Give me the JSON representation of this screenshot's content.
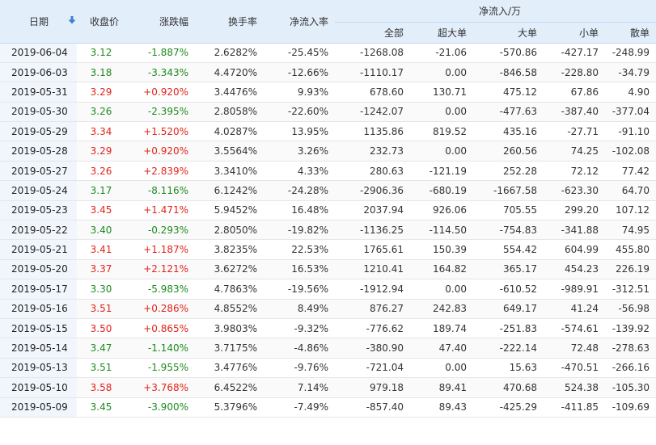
{
  "header": {
    "date": "日期",
    "close": "收盘价",
    "change": "涨跌幅",
    "turnover": "换手率",
    "net_rate": "净流入率",
    "net_flow_group": "净流入/万",
    "all": "全部",
    "xlarge": "超大单",
    "large": "大单",
    "small": "小单",
    "retail": "散单"
  },
  "colors": {
    "up": "#e3231b",
    "down": "#1e8a1e",
    "header_bg": "#e3eefb",
    "sort_icon": "#3b7fd4"
  },
  "rows": [
    {
      "date": "2019-06-04",
      "close": "3.12",
      "change": "-1.887%",
      "turnover": "2.6282%",
      "rate": "-25.45%",
      "all": "-1268.08",
      "xl": "-21.06",
      "l": "-570.86",
      "s": "-427.17",
      "r": "-248.99",
      "dir": "down"
    },
    {
      "date": "2019-06-03",
      "close": "3.18",
      "change": "-3.343%",
      "turnover": "4.4720%",
      "rate": "-12.66%",
      "all": "-1110.17",
      "xl": "0.00",
      "l": "-846.58",
      "s": "-228.80",
      "r": "-34.79",
      "dir": "down"
    },
    {
      "date": "2019-05-31",
      "close": "3.29",
      "change": "+0.920%",
      "turnover": "3.4476%",
      "rate": "9.93%",
      "all": "678.60",
      "xl": "130.71",
      "l": "475.12",
      "s": "67.86",
      "r": "4.90",
      "dir": "up"
    },
    {
      "date": "2019-05-30",
      "close": "3.26",
      "change": "-2.395%",
      "turnover": "2.8058%",
      "rate": "-22.60%",
      "all": "-1242.07",
      "xl": "0.00",
      "l": "-477.63",
      "s": "-387.40",
      "r": "-377.04",
      "dir": "down"
    },
    {
      "date": "2019-05-29",
      "close": "3.34",
      "change": "+1.520%",
      "turnover": "4.0287%",
      "rate": "13.95%",
      "all": "1135.86",
      "xl": "819.52",
      "l": "435.16",
      "s": "-27.71",
      "r": "-91.10",
      "dir": "up"
    },
    {
      "date": "2019-05-28",
      "close": "3.29",
      "change": "+0.920%",
      "turnover": "3.5564%",
      "rate": "3.26%",
      "all": "232.73",
      "xl": "0.00",
      "l": "260.56",
      "s": "74.25",
      "r": "-102.08",
      "dir": "up"
    },
    {
      "date": "2019-05-27",
      "close": "3.26",
      "change": "+2.839%",
      "turnover": "3.3410%",
      "rate": "4.33%",
      "all": "280.63",
      "xl": "-121.19",
      "l": "252.28",
      "s": "72.12",
      "r": "77.42",
      "dir": "up"
    },
    {
      "date": "2019-05-24",
      "close": "3.17",
      "change": "-8.116%",
      "turnover": "6.1242%",
      "rate": "-24.28%",
      "all": "-2906.36",
      "xl": "-680.19",
      "l": "-1667.58",
      "s": "-623.30",
      "r": "64.70",
      "dir": "down"
    },
    {
      "date": "2019-05-23",
      "close": "3.45",
      "change": "+1.471%",
      "turnover": "5.9452%",
      "rate": "16.48%",
      "all": "2037.94",
      "xl": "926.06",
      "l": "705.55",
      "s": "299.20",
      "r": "107.12",
      "dir": "up"
    },
    {
      "date": "2019-05-22",
      "close": "3.40",
      "change": "-0.293%",
      "turnover": "2.8050%",
      "rate": "-19.82%",
      "all": "-1136.25",
      "xl": "-114.50",
      "l": "-754.83",
      "s": "-341.88",
      "r": "74.95",
      "dir": "down"
    },
    {
      "date": "2019-05-21",
      "close": "3.41",
      "change": "+1.187%",
      "turnover": "3.8235%",
      "rate": "22.53%",
      "all": "1765.61",
      "xl": "150.39",
      "l": "554.42",
      "s": "604.99",
      "r": "455.80",
      "dir": "up"
    },
    {
      "date": "2019-05-20",
      "close": "3.37",
      "change": "+2.121%",
      "turnover": "3.6272%",
      "rate": "16.53%",
      "all": "1210.41",
      "xl": "164.82",
      "l": "365.17",
      "s": "454.23",
      "r": "226.19",
      "dir": "up"
    },
    {
      "date": "2019-05-17",
      "close": "3.30",
      "change": "-5.983%",
      "turnover": "4.7863%",
      "rate": "-19.56%",
      "all": "-1912.94",
      "xl": "0.00",
      "l": "-610.52",
      "s": "-989.91",
      "r": "-312.51",
      "dir": "down"
    },
    {
      "date": "2019-05-16",
      "close": "3.51",
      "change": "+0.286%",
      "turnover": "4.8552%",
      "rate": "8.49%",
      "all": "876.27",
      "xl": "242.83",
      "l": "649.17",
      "s": "41.24",
      "r": "-56.98",
      "dir": "up"
    },
    {
      "date": "2019-05-15",
      "close": "3.50",
      "change": "+0.865%",
      "turnover": "3.9803%",
      "rate": "-9.32%",
      "all": "-776.62",
      "xl": "189.74",
      "l": "-251.83",
      "s": "-574.61",
      "r": "-139.92",
      "dir": "up"
    },
    {
      "date": "2019-05-14",
      "close": "3.47",
      "change": "-1.140%",
      "turnover": "3.7175%",
      "rate": "-4.86%",
      "all": "-380.90",
      "xl": "47.40",
      "l": "-222.14",
      "s": "72.48",
      "r": "-278.63",
      "dir": "down"
    },
    {
      "date": "2019-05-13",
      "close": "3.51",
      "change": "-1.955%",
      "turnover": "3.4776%",
      "rate": "-9.76%",
      "all": "-721.04",
      "xl": "0.00",
      "l": "15.63",
      "s": "-470.51",
      "r": "-266.16",
      "dir": "down"
    },
    {
      "date": "2019-05-10",
      "close": "3.58",
      "change": "+3.768%",
      "turnover": "6.4522%",
      "rate": "7.14%",
      "all": "979.18",
      "xl": "89.41",
      "l": "470.68",
      "s": "524.38",
      "r": "-105.30",
      "dir": "up"
    },
    {
      "date": "2019-05-09",
      "close": "3.45",
      "change": "-3.900%",
      "turnover": "5.3796%",
      "rate": "-7.49%",
      "all": "-857.40",
      "xl": "89.43",
      "l": "-425.29",
      "s": "-411.85",
      "r": "-109.69",
      "dir": "down"
    }
  ]
}
